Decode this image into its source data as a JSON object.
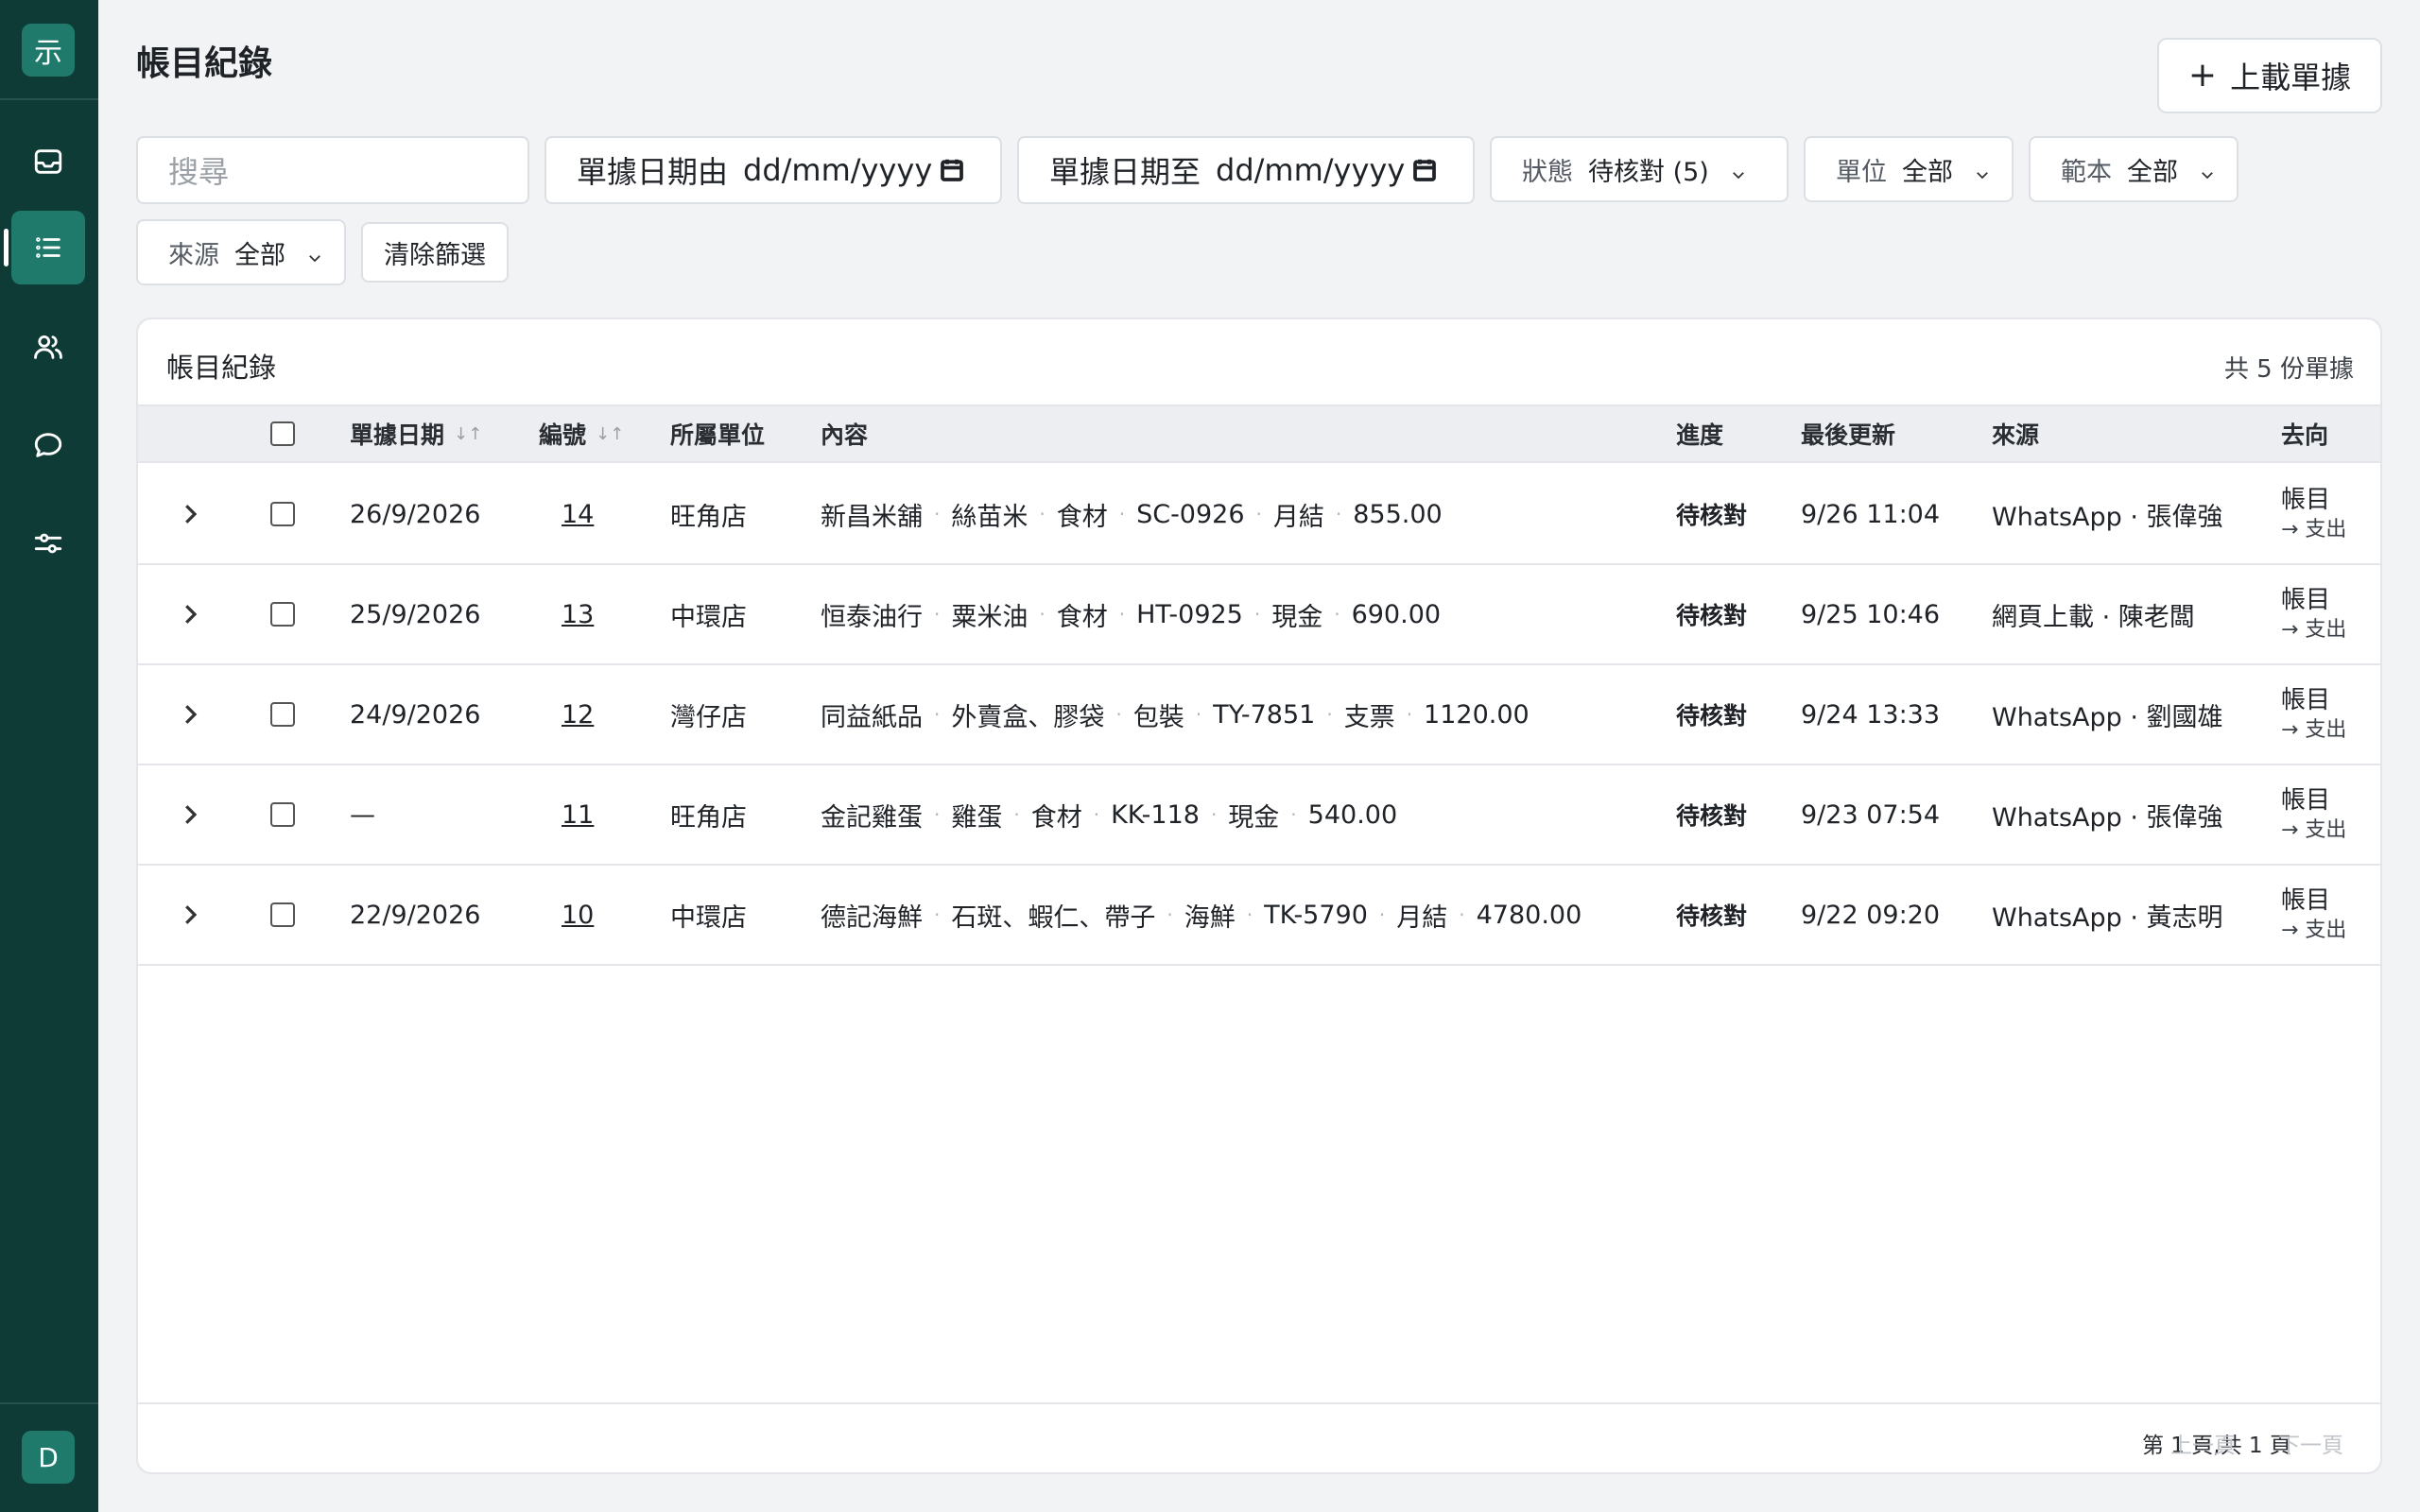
{
  "sidebar": {
    "logo": "示",
    "avatar": "D",
    "items": [
      {
        "icon": "inbox-icon",
        "active": false
      },
      {
        "icon": "list-icon",
        "active": true
      },
      {
        "icon": "users-icon",
        "active": false
      },
      {
        "icon": "chat-icon",
        "active": false
      },
      {
        "icon": "sliders-icon",
        "active": false
      }
    ]
  },
  "header": {
    "title": "帳目紀錄",
    "upload_label": "上載單據"
  },
  "filters": {
    "search_placeholder": "搜尋",
    "date_from_label": "單據日期由",
    "date_from_value": "dd/mm/yyyy",
    "date_to_label": "單據日期至",
    "date_to_value": "dd/mm/yyyy",
    "status_label": "狀態",
    "status_value": "待核對 (5)",
    "unit_label": "單位",
    "unit_value": "全部",
    "template_label": "範本",
    "template_value": "全部",
    "source_label": "來源",
    "source_value": "全部",
    "clear_label": "清除篩選"
  },
  "table": {
    "title": "帳目紀錄",
    "count": "共 5 份單據",
    "columns": {
      "date": "單據日期",
      "number": "編號",
      "unit": "所屬單位",
      "content": "內容",
      "progress": "進度",
      "updated": "最後更新",
      "source": "來源",
      "destination": "去向"
    },
    "rows": [
      {
        "date": "26/9/2026",
        "number": "14",
        "unit": "旺角店",
        "vendor": "新昌米舖",
        "item": "絲苗米",
        "category": "食材",
        "ref": "SC-0926",
        "payment": "月結",
        "amount": "855.00",
        "status": "待核對",
        "updated": "9/26 11:04",
        "source": "WhatsApp · 張偉強",
        "dest_main": "帳目",
        "dest_sub": "→ 支出"
      },
      {
        "date": "25/9/2026",
        "number": "13",
        "unit": "中環店",
        "vendor": "恒泰油行",
        "item": "粟米油",
        "category": "食材",
        "ref": "HT-0925",
        "payment": "現金",
        "amount": "690.00",
        "status": "待核對",
        "updated": "9/25 10:46",
        "source": "網頁上載 · 陳老闆",
        "dest_main": "帳目",
        "dest_sub": "→ 支出"
      },
      {
        "date": "24/9/2026",
        "number": "12",
        "unit": "灣仔店",
        "vendor": "同益紙品",
        "item": "外賣盒、膠袋",
        "category": "包裝",
        "ref": "TY-7851",
        "payment": "支票",
        "amount": "1120.00",
        "status": "待核對",
        "updated": "9/24 13:33",
        "source": "WhatsApp · 劉國雄",
        "dest_main": "帳目",
        "dest_sub": "→ 支出"
      },
      {
        "date": "—",
        "number": "11",
        "unit": "旺角店",
        "vendor": "金記雞蛋",
        "item": "雞蛋",
        "category": "食材",
        "ref": "KK-118",
        "payment": "現金",
        "amount": "540.00",
        "status": "待核對",
        "updated": "9/23 07:54",
        "source": "WhatsApp · 張偉強",
        "dest_main": "帳目",
        "dest_sub": "→ 支出"
      },
      {
        "date": "22/9/2026",
        "number": "10",
        "unit": "中環店",
        "vendor": "德記海鮮",
        "item": "石斑、蝦仁、帶子",
        "category": "海鮮",
        "ref": "TK-5790",
        "payment": "月結",
        "amount": "4780.00",
        "status": "待核對",
        "updated": "9/22 09:20",
        "source": "WhatsApp · 黃志明",
        "dest_main": "帳目",
        "dest_sub": "→ 支出"
      }
    ]
  },
  "pagination": {
    "info": "第 1 頁,共 1 頁",
    "prev": "上一頁",
    "next": "下一頁"
  },
  "colors": {
    "sidebar": "#0e3b36",
    "accent": "#1f7a6c",
    "background": "#f2f3f5"
  }
}
